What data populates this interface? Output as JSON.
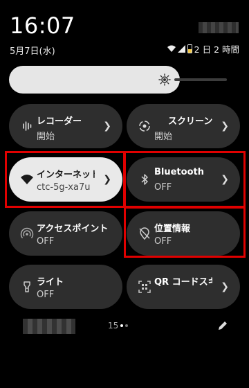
{
  "status": {
    "time": "16:07",
    "date": "5月7日(水)",
    "battery_text": "2 日 2 時間"
  },
  "brightness": {
    "level": 0.75
  },
  "tiles": [
    {
      "title": "レコーダー",
      "sub": "開始",
      "icon": "waveform-icon",
      "active": false
    },
    {
      "title": "スクリーン",
      "sub": "開始",
      "icon": "record-icon",
      "active": false
    },
    {
      "title": "インターネット",
      "sub": "ctc-5g-xa7u",
      "icon": "wifi-icon",
      "active": true
    },
    {
      "title": "Bluetooth",
      "sub": "OFF",
      "icon": "bluetooth-icon",
      "active": false
    },
    {
      "title": "アクセスポイント",
      "sub": "OFF",
      "icon": "hotspot-icon",
      "active": false
    },
    {
      "title": "位置情報",
      "sub": "OFF",
      "icon": "location-off-icon",
      "active": false
    },
    {
      "title": "ライト",
      "sub": "OFF",
      "icon": "flashlight-icon",
      "active": false
    },
    {
      "title": "QR コードスキャナー",
      "sub": "",
      "icon": "qr-scan-icon",
      "active": false
    }
  ],
  "pager": {
    "label": "15",
    "page": 1,
    "pages": 2
  },
  "colors": {
    "highlight": "#e00000",
    "tile_bg": "#2e2e2e",
    "tile_active_bg": "#e9e9e9"
  }
}
